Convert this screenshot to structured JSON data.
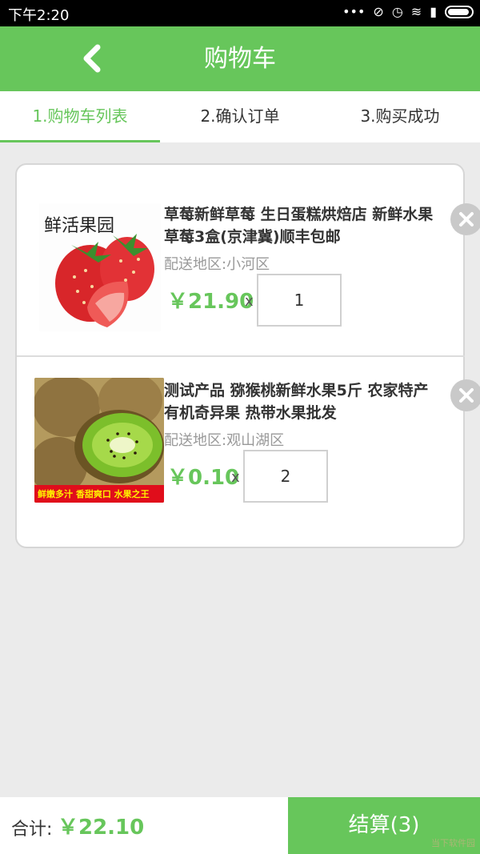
{
  "status_bar": {
    "time": "下午2:20",
    "icons": [
      "more-icon",
      "mute-icon",
      "alarm-icon",
      "wifi-icon",
      "signal-icon",
      "battery-icon"
    ]
  },
  "header": {
    "title": "购物车",
    "back_icon": "chevron-left-icon"
  },
  "tabs": [
    {
      "label": "1.购物车列表",
      "active": true
    },
    {
      "label": "2.确认订单",
      "active": false
    },
    {
      "label": "3.购买成功",
      "active": false
    }
  ],
  "cart_items": [
    {
      "title": "草莓新鲜草莓 生日蛋糕烘焙店 新鲜水果草莓3盒(京津冀)顺丰包邮",
      "region": "配送地区:小河区",
      "price": "￥21.90",
      "times": "x",
      "quantity": "1",
      "image_text": "鲜活果园"
    },
    {
      "title": "测试产品 猕猴桃新鲜水果5斤 农家特产有机奇异果 热带水果批发",
      "region": "配送地区:观山湖区",
      "price": "￥0.10",
      "times": "x",
      "quantity": "2",
      "image_text": "鲜嫩多汁 香甜爽口 水果之王"
    }
  ],
  "footer": {
    "total_label": "合计:",
    "total_value": "￥22.10",
    "checkout_label": "结算(3)"
  },
  "watermark": "当下软件园",
  "colors": {
    "accent": "#67c65b",
    "header_bg": "#67c65b",
    "page_bg": "#ebebeb",
    "status_bar_bg": "#000000"
  }
}
